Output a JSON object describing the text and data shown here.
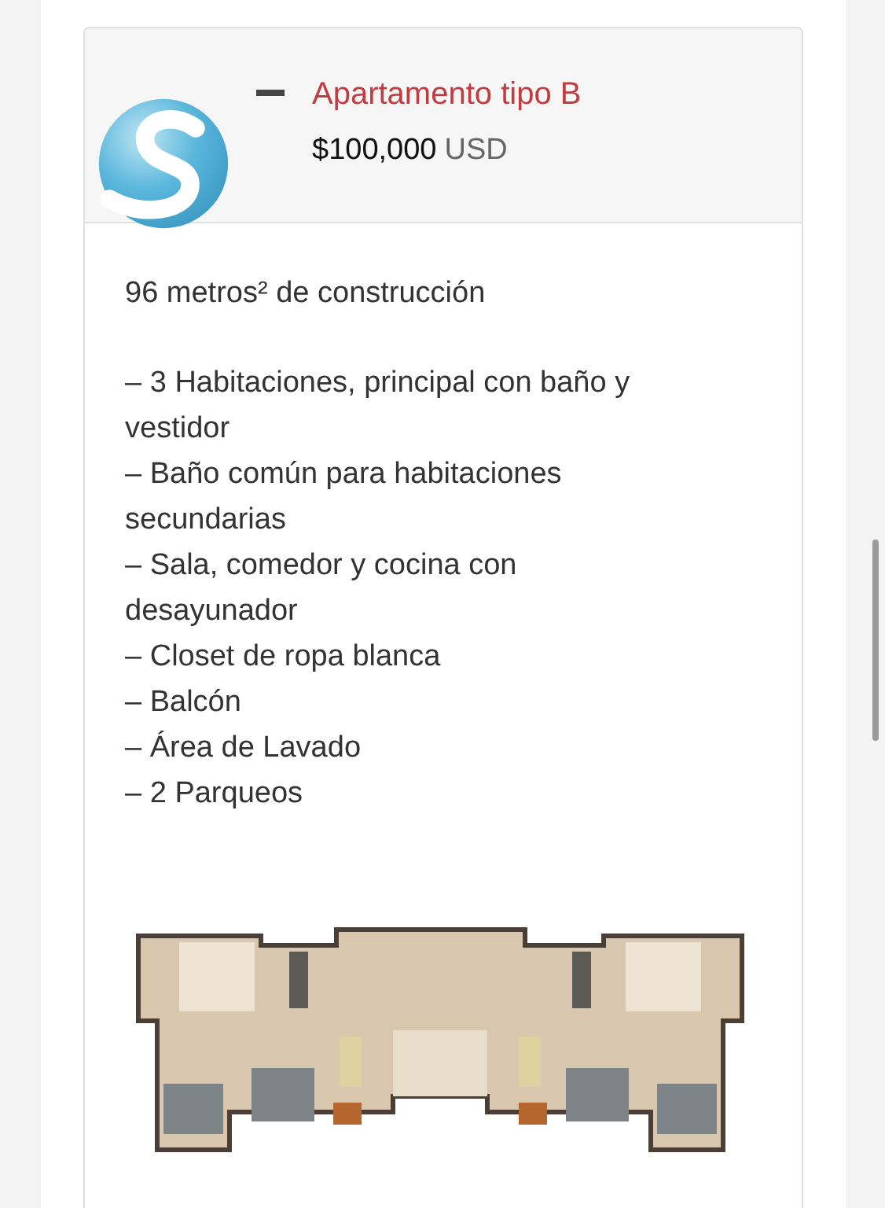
{
  "accordion": {
    "expanded": true,
    "title": "Apartamento tipo B",
    "price": "$100,000",
    "currency": "USD"
  },
  "description": "96 metros² de construcción",
  "features": [
    "– 3 Habitaciones, principal con baño y vestidor",
    "– Baño común para habitaciones secundarias",
    "– Sala, comedor y cocina con desayunador",
    "– Closet de ropa blanca",
    "– Balcón",
    "– Área de Lavado",
    "– 2 Parqueos"
  ]
}
